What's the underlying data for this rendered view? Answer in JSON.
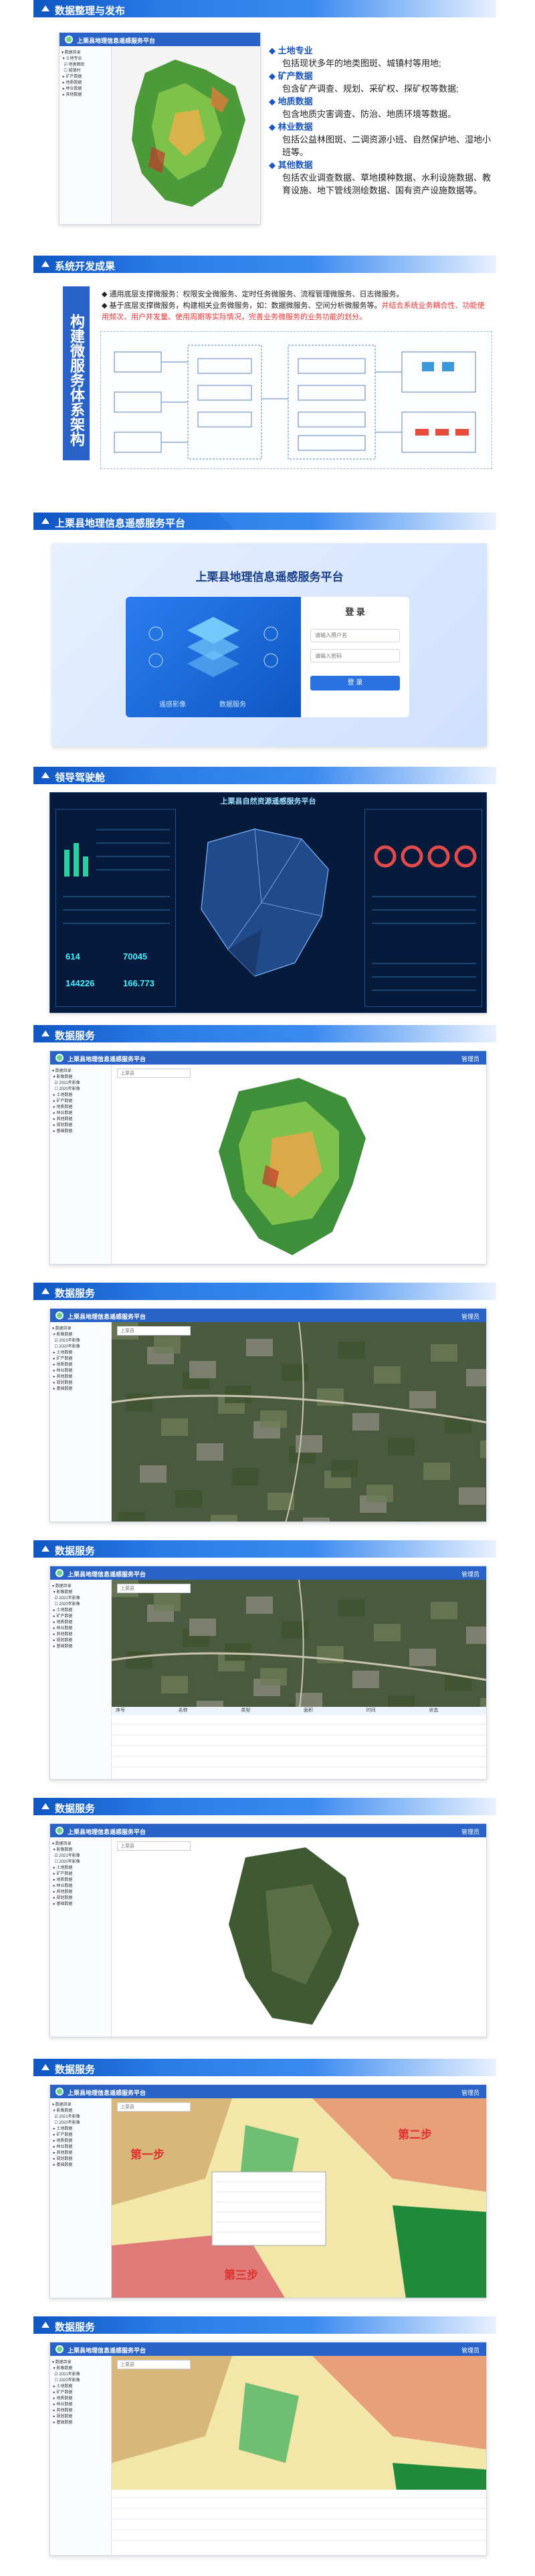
{
  "sections": {
    "s1": {
      "title": "数据整理与发布"
    },
    "s2": {
      "title": "系统开发成果"
    },
    "s3": {
      "title": "上栗县地理信息遥感服务平台"
    },
    "s4": {
      "title": "领导驾驶舱"
    },
    "s5": {
      "title": "数据服务"
    },
    "s6": {
      "title": "数据服务"
    },
    "s7": {
      "title": "数据服务"
    },
    "s8": {
      "title": "数据服务"
    },
    "s9": {
      "title": "数据服务"
    },
    "s10": {
      "title": "数据服务"
    }
  },
  "app": {
    "title": "上栗县地理信息遥感服务平台",
    "search_placeholder": "上栗县",
    "user": "管理员"
  },
  "s1_list": [
    {
      "head": "土地专业",
      "body": "包括现状多年的地类图斑、城镇村等用地;"
    },
    {
      "head": "矿产数据",
      "body": "包含矿产调查、规划、采矿权、探矿权等数据;"
    },
    {
      "head": "地质数据",
      "body": "包含地质灾害调查、防治、地质环境等数据。"
    },
    {
      "head": "林业数据",
      "body": "包括公益林图斑、二调资源小班、自然保护地、湿地小班等。"
    },
    {
      "head": "其他数据",
      "body": "包括农业调查数据、草地摸种数据、水利设施数据、教育设施、地下管线测绘数据、国有资产设施数据等。"
    }
  ],
  "s2": {
    "vertical_label": "构建微服务体系架构",
    "bullet1": "通用底层支撑微服务：权限安全微服务、定时任务微服务、流程管理微服务、日志微服务。",
    "bullet2_normal": "基于底层支撑微服务，构建相关业务微服务，如：数据微服务、空间分析微服务等。",
    "bullet2_red": "并结合系统业务耦合性、功能使用频次、用户并发量、使用周期等实际情况，完善业务微服务的业务功能的划分。"
  },
  "login": {
    "platform_title": "上栗县地理信息遥感服务平台",
    "login_title": "登 录",
    "username_placeholder": "请输入用户名",
    "password_placeholder": "请输入密码",
    "login_button": "登 录",
    "feature_a": "遥感影像",
    "feature_b": "数据服务"
  },
  "cockpit": {
    "title": "上栗县自然资源遥感服务平台",
    "kpis": [
      "614",
      "70045",
      "144226",
      "166.773"
    ]
  },
  "s7_table": {
    "headers": [
      "序号",
      "名称",
      "类型",
      "面积",
      "时间",
      "状态"
    ]
  },
  "s9_notes": {
    "step1": "第一步",
    "step2": "第二步",
    "step3": "第三步"
  },
  "colors": {
    "banner": "#1f6fd8",
    "accent": "#2a63c7",
    "note_red": "#e03030"
  }
}
